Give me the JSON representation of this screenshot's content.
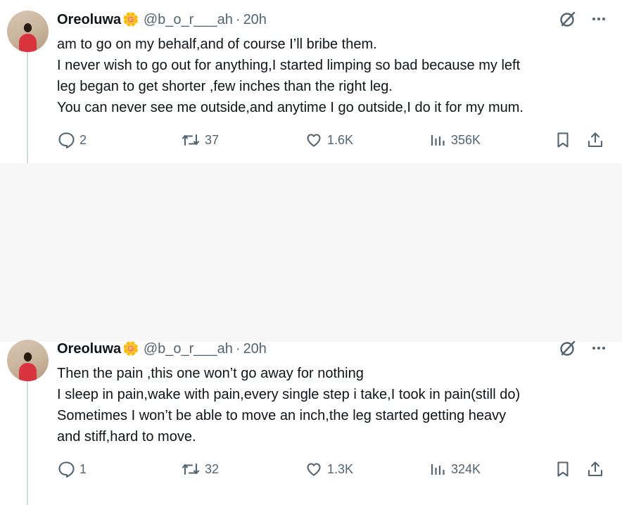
{
  "tweets": [
    {
      "author": {
        "name": "Oreoluwa",
        "emoji": "🌼",
        "handle": "@b_o_r___ah",
        "separator": "·",
        "time": "20h"
      },
      "lines": [
        "am to go on my behalf,and of course I’ll bribe them.",
        "I never wish to go out for anything,I started limping so bad because my left",
        "leg began to get shorter ,few inches than the right leg.",
        "You can never see me outside,and anytime I go outside,I do it for my mum."
      ],
      "stats": {
        "replies": "2",
        "reposts": "37",
        "likes": "1.6K",
        "views": "356K"
      }
    },
    {
      "author": {
        "name": "Oreoluwa",
        "emoji": "🌼",
        "handle": "@b_o_r___ah",
        "separator": "·",
        "time": "20h"
      },
      "lines": [
        "Then the pain ,this one won’t go away for nothing",
        "I sleep in pain,wake with pain,every single step i take,I took in pain(still do)",
        "Sometimes I won’t be able to move an inch,the leg started getting heavy",
        "and stiff,hard to move."
      ],
      "stats": {
        "replies": "1",
        "reposts": "32",
        "likes": "1.3K",
        "views": "324K"
      }
    }
  ],
  "icons": {
    "grok": "grok-icon",
    "more": "more-icon",
    "reply": "reply-icon",
    "repost": "repost-icon",
    "like": "heart-icon",
    "views": "views-icon",
    "bookmark": "bookmark-icon",
    "share": "share-icon"
  },
  "colors": {
    "text": "#0f1419",
    "muted": "#536471",
    "thread_line": "#cfd9de",
    "highlight_bg": "#f7f7f7"
  }
}
